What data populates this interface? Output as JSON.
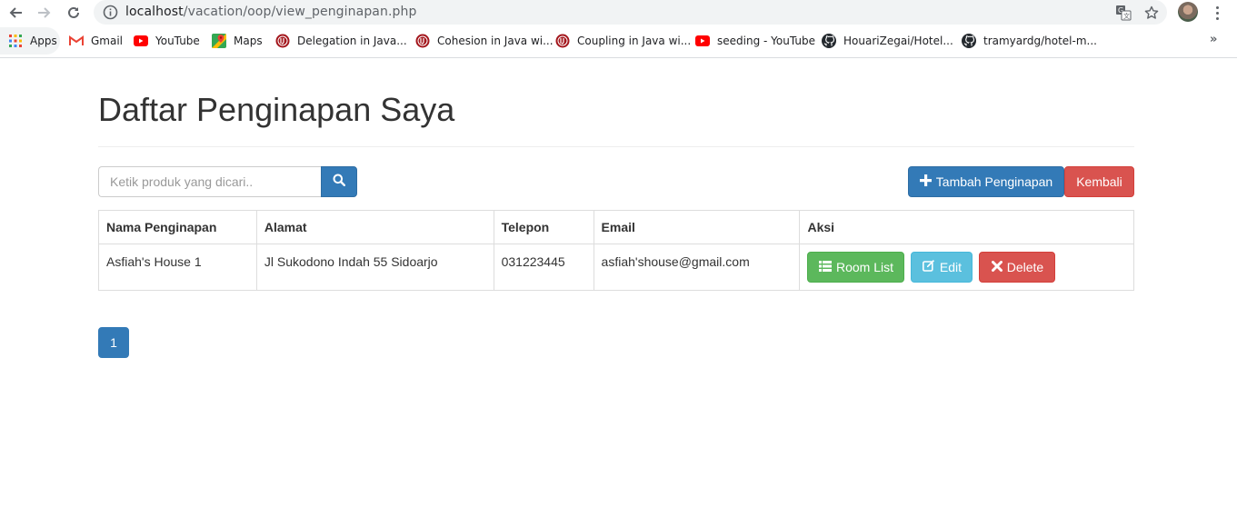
{
  "browser": {
    "url_host": "localhost",
    "url_path": "/vacation/oop/view_penginapan.php",
    "bookmarks": [
      {
        "label": "Apps",
        "icon": "apps-grid-icon"
      },
      {
        "label": "Gmail",
        "icon": "gmail-icon"
      },
      {
        "label": "YouTube",
        "icon": "youtube-icon"
      },
      {
        "label": "Maps",
        "icon": "maps-icon"
      },
      {
        "label": "Delegation in Java...",
        "icon": "site-favicon-icon"
      },
      {
        "label": "Cohesion in Java wi...",
        "icon": "site-favicon-icon"
      },
      {
        "label": "Coupling in Java wi...",
        "icon": "site-favicon-icon"
      },
      {
        "label": "seeding - YouTube",
        "icon": "youtube-icon"
      },
      {
        "label": "HouariZegai/Hotel...",
        "icon": "github-icon"
      },
      {
        "label": "tramyardg/hotel-m...",
        "icon": "github-icon"
      }
    ],
    "overflow_label": "»"
  },
  "page": {
    "title": "Daftar Penginapan Saya",
    "search_placeholder": "Ketik produk yang dicari..",
    "add_button": "Tambah Penginapan",
    "back_button": "Kembali",
    "pagination": [
      "1"
    ]
  },
  "table": {
    "headers": [
      "Nama Penginapan",
      "Alamat",
      "Telepon",
      "Email",
      "Aksi"
    ],
    "rows": [
      {
        "nama": "Asfiah's House 1",
        "alamat": "Jl Sukodono Indah 55 Sidoarjo",
        "telepon": "031223445",
        "email": "asfiah'shouse@gmail.com"
      }
    ],
    "actions": {
      "room_list": "Room List",
      "edit": "Edit",
      "delete": "Delete"
    }
  },
  "colors": {
    "primary": "#337ab7",
    "danger": "#d9534f",
    "success": "#5cb85c",
    "info": "#5bc0de"
  }
}
